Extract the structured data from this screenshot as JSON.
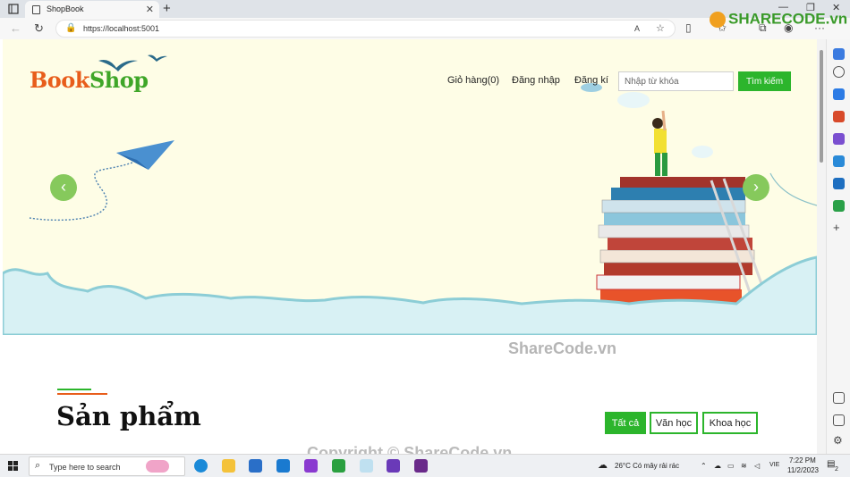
{
  "browser": {
    "tab_title": "ShopBook",
    "tab_close": "✕",
    "new_tab": "+",
    "url": "https://localhost:5001"
  },
  "watermark": {
    "brand": "SHARECODE.vn",
    "center": "ShareCode.vn",
    "bottom": "Copyright © ShareCode.vn"
  },
  "site": {
    "logo_part1": "Book",
    "logo_part2": "Shop",
    "nav": {
      "cart": "Giỏ hàng(0)",
      "login": "Đăng nhập",
      "register": "Đăng kí"
    },
    "search": {
      "placeholder": "Nhập từ khóa",
      "button": "Tìm kiếm"
    },
    "slider": {
      "prev": "‹",
      "next": "›"
    },
    "section": {
      "title": "Sản phẩm",
      "filters": [
        "Tất cả",
        "Văn học",
        "Khoa học"
      ]
    }
  },
  "taskbar": {
    "search_placeholder": "Type here to search",
    "weather": "26°C  Có mây rải rác",
    "lang": "VIE",
    "time": "7:22 PM",
    "date": "11/2/2023",
    "notif_count": "2"
  },
  "colors": {
    "brand_orange": "#e85d1b",
    "brand_green": "#3fa628",
    "accent_green": "#2cb52c",
    "hero_bg": "#fefde6"
  }
}
